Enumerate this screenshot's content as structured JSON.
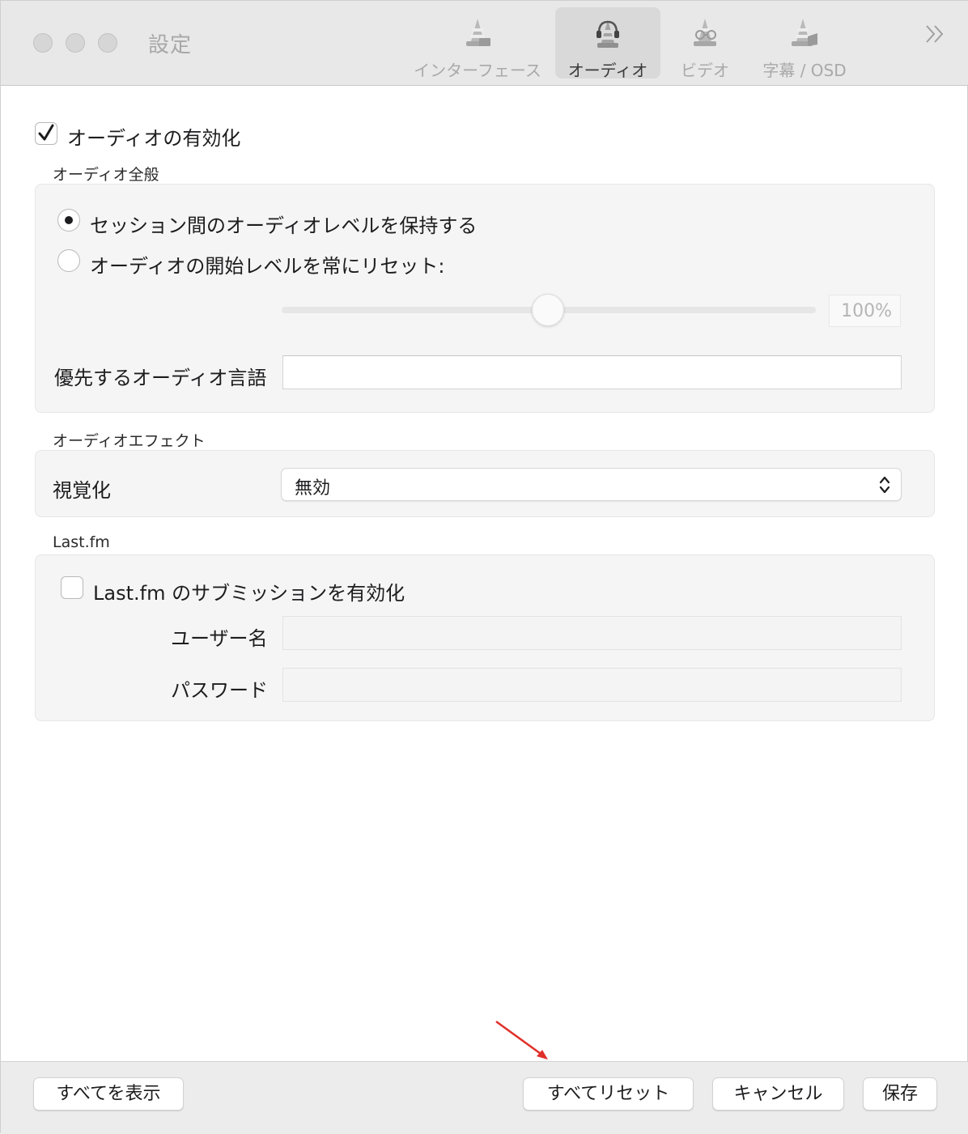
{
  "window": {
    "title": "設定"
  },
  "toolbar": {
    "tabs": [
      {
        "label": "インターフェース",
        "icon": "vlc-cone-interface-icon",
        "active": false
      },
      {
        "label": "オーディオ",
        "icon": "vlc-cone-headphones-icon",
        "active": true
      },
      {
        "label": "ビデオ",
        "icon": "vlc-cone-glasses-icon",
        "active": false
      },
      {
        "label": "字幕 / OSD",
        "icon": "vlc-cone-subtitle-icon",
        "active": false
      }
    ],
    "overflow_icon": "double-chevron-right-icon"
  },
  "audio": {
    "enable_label": "オーディオの有効化",
    "enable_checked": true
  },
  "general": {
    "title": "オーディオ全般",
    "radio_keep_label": "セッション間のオーディオレベルを保持する",
    "radio_keep_selected": true,
    "radio_reset_label": "オーディオの開始レベルを常にリセット:",
    "radio_reset_selected": false,
    "level_value": "100%",
    "level_fraction": 0.5,
    "preferred_language_label": "優先するオーディオ言語",
    "preferred_language_value": ""
  },
  "effects": {
    "title": "オーディオエフェクト",
    "visualization_label": "視覚化",
    "visualization_value": "無効"
  },
  "lastfm": {
    "title": "Last.fm",
    "submit_label": "Last.fm のサブミッションを有効化",
    "submit_checked": false,
    "username_label": "ユーザー名",
    "username_value": "",
    "password_label": "パスワード",
    "password_value": ""
  },
  "footer": {
    "show_all_label": "すべてを表示",
    "reset_all_label": "すべてリセット",
    "cancel_label": "キャンセル",
    "save_label": "保存"
  },
  "annotation": {
    "arrow_color": "#e0302a"
  }
}
